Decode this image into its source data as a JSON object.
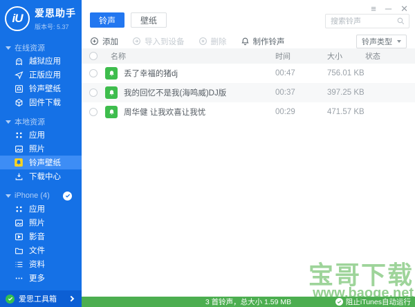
{
  "app": {
    "title": "爱思助手",
    "version": "版本号: 5.37",
    "logo": "iU"
  },
  "window_controls": {
    "menu": "≡",
    "minimize": "─",
    "close": "✕"
  },
  "tabs": {
    "ringtone": "铃声",
    "wallpaper": "壁纸"
  },
  "search": {
    "placeholder": "搜索铃声"
  },
  "toolbar": {
    "add": "添加",
    "import": "导入到设备",
    "delete": "删除",
    "make_ringtone": "制作铃声",
    "type_filter": "铃声类型"
  },
  "sidebar": {
    "sections": [
      {
        "label": "在线资源",
        "items": [
          {
            "label": "越狱应用"
          },
          {
            "label": "正版应用"
          },
          {
            "label": "铃声壁纸"
          },
          {
            "label": "固件下载"
          }
        ]
      },
      {
        "label": "本地资源",
        "items": [
          {
            "label": "应用"
          },
          {
            "label": "照片"
          },
          {
            "label": "铃声壁纸"
          },
          {
            "label": "下载中心"
          }
        ]
      },
      {
        "label": "iPhone (4)",
        "items": [
          {
            "label": "应用"
          },
          {
            "label": "照片"
          },
          {
            "label": "影音"
          },
          {
            "label": "文件"
          },
          {
            "label": "资料"
          },
          {
            "label": "更多"
          }
        ]
      }
    ],
    "toolbox_label": "爱思工具箱"
  },
  "table": {
    "headers": {
      "name": "名称",
      "time": "时间",
      "size": "大小",
      "status": "状态"
    },
    "rows": [
      {
        "name": "丢了幸福的猪dj",
        "time": "00:47",
        "size": "756.01 KB",
        "status": ""
      },
      {
        "name": "我的回忆不是我(海鸣威)DJ版",
        "time": "00:37",
        "size": "397.25 KB",
        "status": ""
      },
      {
        "name": "周华健 让我欢喜让我忧",
        "time": "00:29",
        "size": "471.57 KB",
        "status": ""
      }
    ]
  },
  "footer": {
    "summary": "3 首铃声，总大小 1.59 MB",
    "itunes_block": "阻止iTunes自动运行"
  },
  "watermark": {
    "title": "宝哥下载",
    "url": "www.baoge.net"
  },
  "colors": {
    "sidebar_blue": "#1571e6",
    "selected_blue": "#3d8df5",
    "tab_blue": "#2277f0",
    "footer_green": "#4cae50",
    "ringtone_icon_green": "#3ebd4d",
    "wallpaper_icon_yellow": "#ffd41f"
  }
}
